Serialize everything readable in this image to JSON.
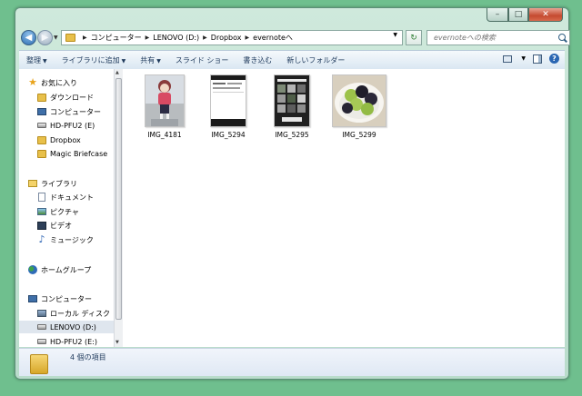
{
  "window": {
    "caption_buttons": {
      "minimize": "–",
      "maximize": "□",
      "close": "✕"
    }
  },
  "address": {
    "crumbs": [
      "コンピューター",
      "LENOVO (D:)",
      "Dropbox",
      "evernoteへ"
    ]
  },
  "search": {
    "placeholder": "evernoteへの検索"
  },
  "toolbar": {
    "items": [
      {
        "label": "整理",
        "arrow": "▼"
      },
      {
        "label": "ライブラリに追加",
        "arrow": "▼"
      },
      {
        "label": "共有",
        "arrow": "▼"
      },
      {
        "label": "スライド ショー",
        "arrow": ""
      },
      {
        "label": "書き込む",
        "arrow": ""
      },
      {
        "label": "新しいフォルダー",
        "arrow": ""
      }
    ],
    "help_label": "?"
  },
  "navpane": {
    "items": [
      {
        "label": "お気に入り",
        "icon": "star-icon"
      },
      {
        "label": "ダウンロード",
        "icon": "folder-icon"
      },
      {
        "label": "コンピューター",
        "icon": "computer-icon"
      },
      {
        "label": "HD-PFU2 (E)",
        "icon": "drive-icon"
      },
      {
        "label": "Dropbox",
        "icon": "folder-icon"
      },
      {
        "label": "Magic Briefcase",
        "icon": "folder-icon"
      },
      {
        "label": "ライブラリ",
        "icon": "library-icon"
      },
      {
        "label": "ドキュメント",
        "icon": "document-icon"
      },
      {
        "label": "ピクチャ",
        "icon": "picture-icon"
      },
      {
        "label": "ビデオ",
        "icon": "video-icon"
      },
      {
        "label": "ミュージック",
        "icon": "music-icon"
      },
      {
        "label": "ホームグループ",
        "icon": "homegroup-icon"
      },
      {
        "label": "コンピューター",
        "icon": "computer-icon"
      },
      {
        "label": "ローカル ディスク",
        "icon": "local-disk-icon"
      },
      {
        "label": "LENOVO (D:)",
        "icon": "drive-icon",
        "selected": true
      },
      {
        "label": "HD-PFU2 (E:)",
        "icon": "drive-icon"
      }
    ]
  },
  "files": [
    {
      "name": "IMG_4181",
      "kind": "portrait-photo"
    },
    {
      "name": "IMG_5294",
      "kind": "phone-screenshot"
    },
    {
      "name": "IMG_5295",
      "kind": "phone-screenshot-dark"
    },
    {
      "name": "IMG_5299",
      "kind": "grapes-photo"
    }
  ],
  "status": {
    "count_text": "4 個の項目"
  },
  "colors": {
    "desktop": "#6fbf8e",
    "window_frame": "#b9dccb",
    "toolbar": "#dae7f2",
    "selection": "#dfe6ee",
    "close_button": "#c54a30"
  }
}
